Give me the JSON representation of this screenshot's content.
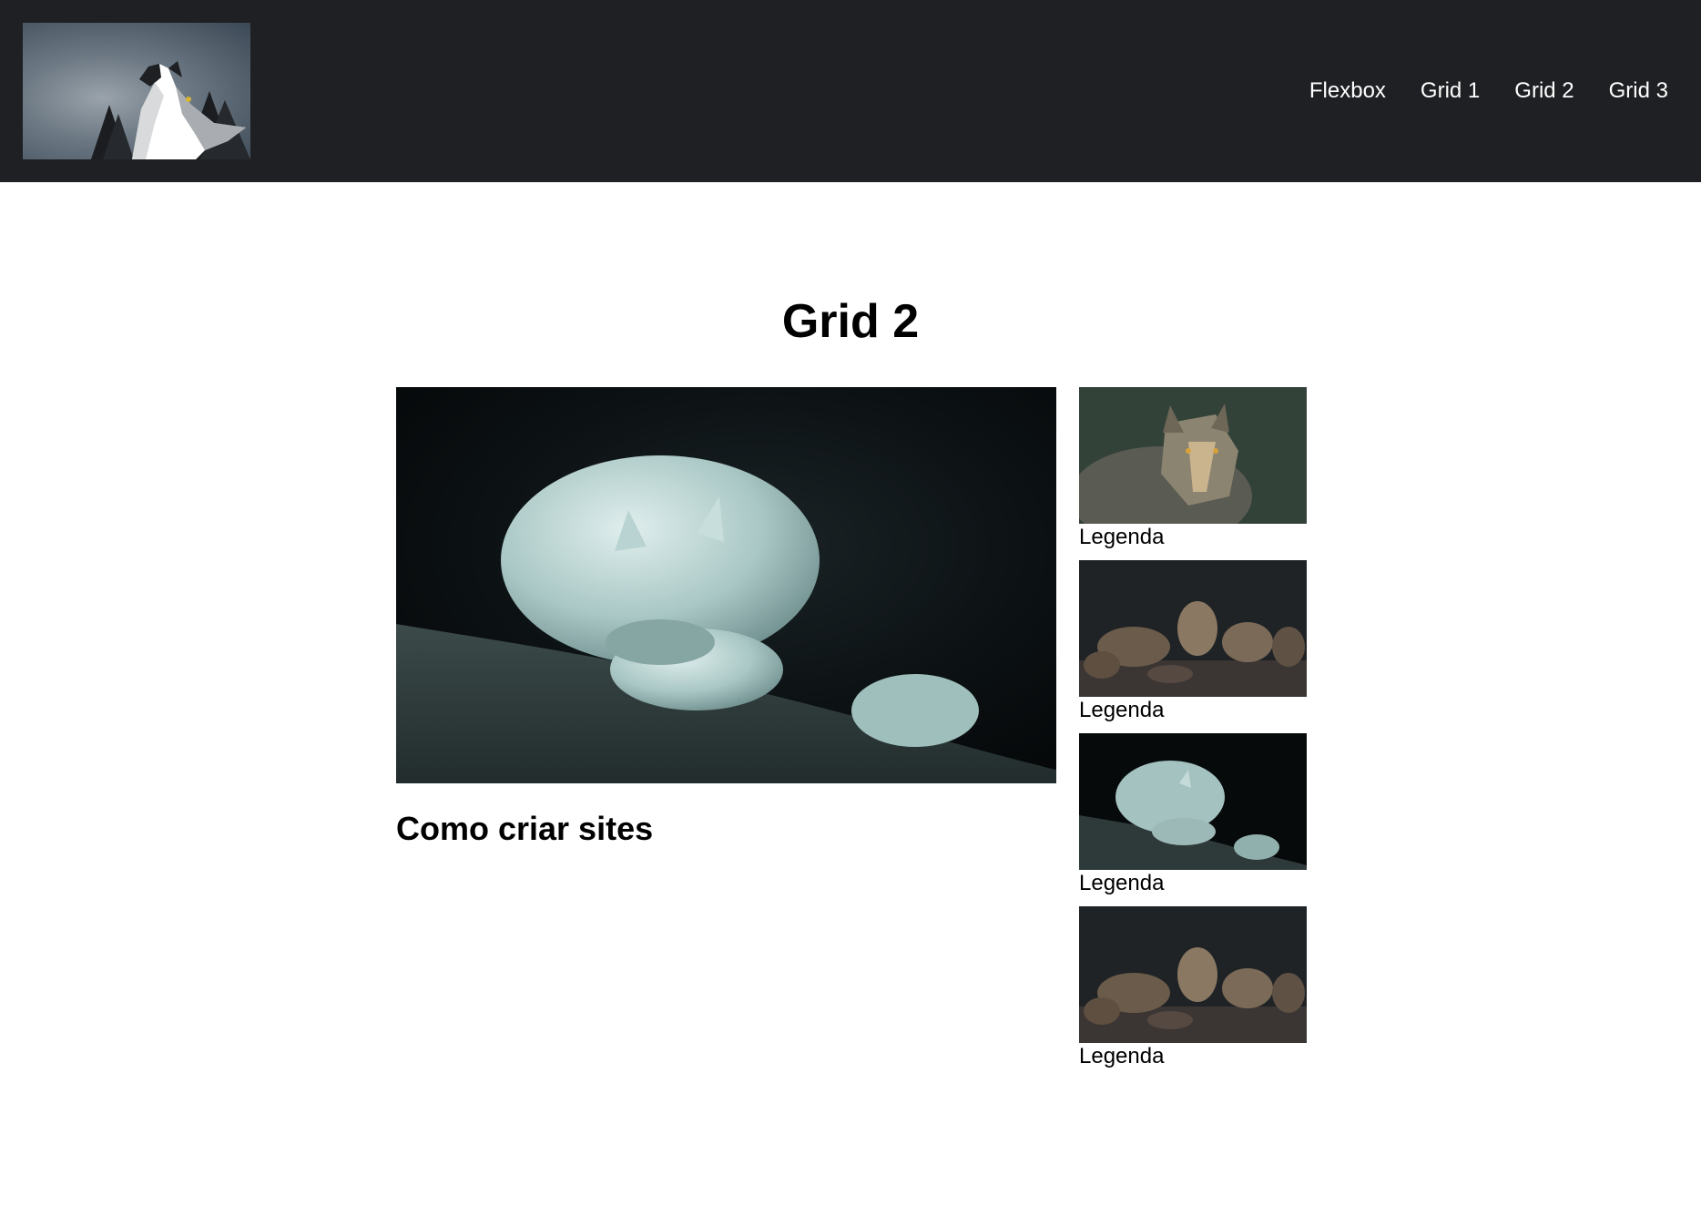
{
  "header": {
    "logo_icon": "howling-wolf-logo",
    "nav": [
      {
        "label": "Flexbox"
      },
      {
        "label": "Grid 1"
      },
      {
        "label": "Grid 2"
      },
      {
        "label": "Grid 3"
      }
    ]
  },
  "main": {
    "title": "Grid 2",
    "feature": {
      "image": "sleeping-white-wolf-photo",
      "heading": "Como criar sites"
    },
    "thumbnails": [
      {
        "image": "gray-wolf-portrait-photo",
        "caption": "Legenda"
      },
      {
        "image": "wolf-pack-photo",
        "caption": "Legenda"
      },
      {
        "image": "sleeping-white-wolf-photo",
        "caption": "Legenda"
      },
      {
        "image": "wolf-pack-photo",
        "caption": "Legenda"
      }
    ]
  },
  "colors": {
    "header_bg": "#1f2023",
    "nav_text": "#ffffff",
    "page_bg": "#ffffff"
  }
}
